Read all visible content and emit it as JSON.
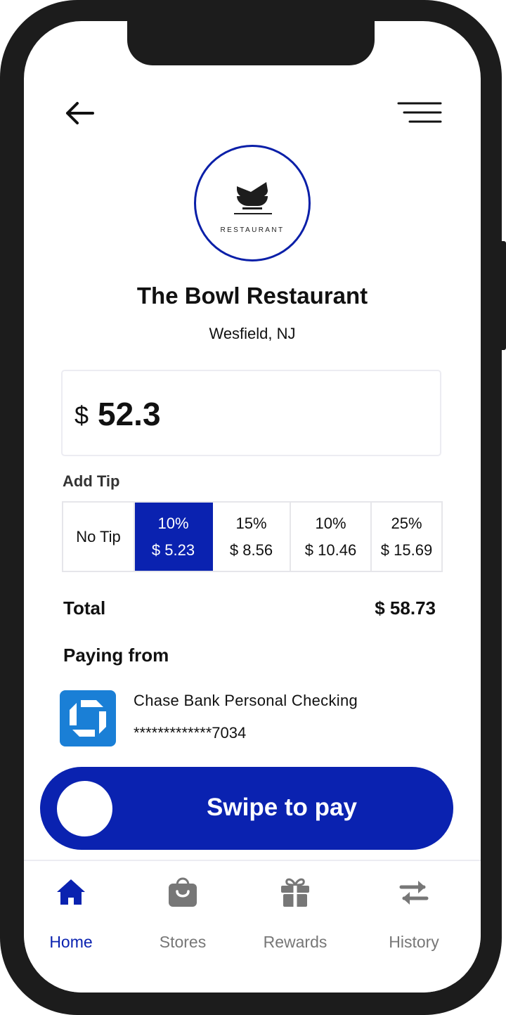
{
  "header": {
    "back_icon": "arrow-left-icon",
    "menu_icon": "hamburger-menu-icon"
  },
  "store": {
    "logo_text": "RESTAURANT",
    "name": "The Bowl Restaurant",
    "location": "Wesfield, NJ"
  },
  "amount": {
    "currency": "$",
    "value": "52.3"
  },
  "tip": {
    "label": "Add Tip",
    "options": [
      {
        "label": "No Tip",
        "amount": ""
      },
      {
        "label": "10%",
        "amount": "$ 5.23"
      },
      {
        "label": "15%",
        "amount": "$ 8.56"
      },
      {
        "label": "10%",
        "amount": "$ 10.46"
      },
      {
        "label": "25%",
        "amount": "$ 15.69"
      }
    ],
    "selected_index": 1
  },
  "total": {
    "label": "Total",
    "value": "$ 58.73"
  },
  "payment": {
    "label": "Paying from",
    "bank_name": "Chase Bank Personal Checking",
    "account_number": "*************7034",
    "bank_icon": "chase-octagon-logo"
  },
  "swipe": {
    "label": "Swipe to pay"
  },
  "tabs": [
    {
      "label": "Home",
      "icon": "home-icon",
      "active": true
    },
    {
      "label": "Stores",
      "icon": "shopping-bag-icon",
      "active": false
    },
    {
      "label": "Rewards",
      "icon": "gift-icon",
      "active": false
    },
    {
      "label": "History",
      "icon": "transfer-arrows-icon",
      "active": false
    }
  ],
  "colors": {
    "primary": "#0a22b0",
    "bank_blue": "#1a7fd6",
    "inactive_tab": "#777777",
    "frame": "#1c1c1c"
  }
}
